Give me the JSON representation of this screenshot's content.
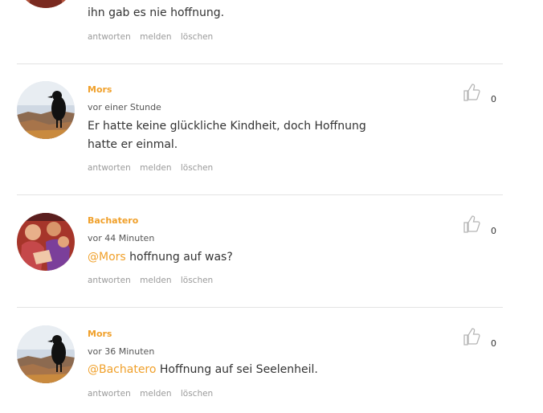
{
  "comments": [
    {
      "text": "ihn gab es nie hoffnung.",
      "actions": {
        "reply": "antworten",
        "report": "melden",
        "delete": "löschen"
      }
    },
    {
      "author": "Mors",
      "time": "vor einer Stunde",
      "text": "Er hatte keine glückliche Kindheit, doch Hoffnung hatte er einmal.",
      "likes": "0",
      "actions": {
        "reply": "antworten",
        "report": "melden",
        "delete": "löschen"
      }
    },
    {
      "author": "Bachatero",
      "time": "vor 44 Minuten",
      "mention": "@Mors",
      "text": " hoffnung auf was?",
      "likes": "0",
      "actions": {
        "reply": "antworten",
        "report": "melden",
        "delete": "löschen"
      }
    },
    {
      "author": "Mors",
      "time": "vor 36 Minuten",
      "mention": "@Bachatero",
      "text": " Hoffnung auf sei Seelenheil.",
      "likes": "0",
      "actions": {
        "reply": "antworten",
        "report": "melden",
        "delete": "löschen"
      }
    }
  ],
  "colors": {
    "accent": "#f0a02a",
    "divider": "#e3e3e3",
    "muted": "#9a9a9a"
  }
}
